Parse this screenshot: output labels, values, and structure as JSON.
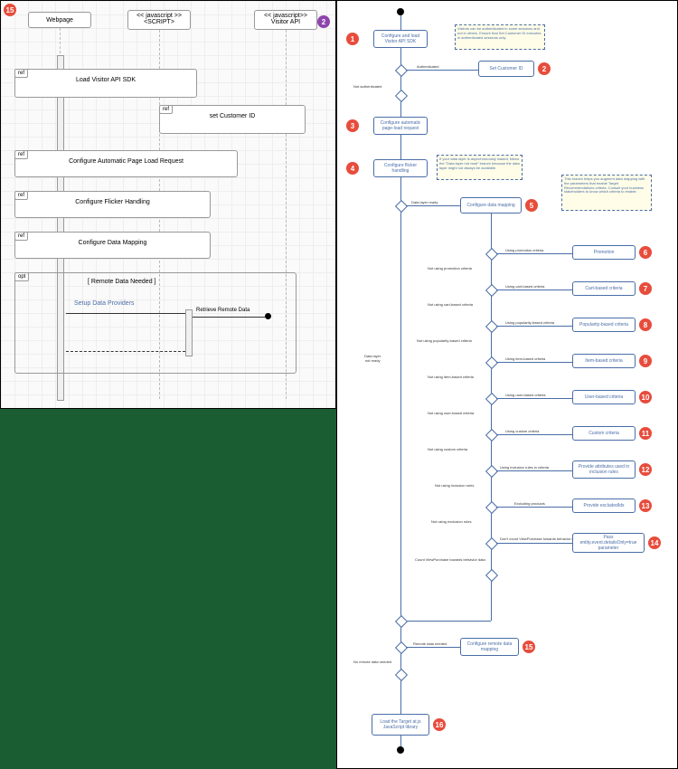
{
  "left": {
    "badge15": "15",
    "badge2": "2",
    "heads": {
      "webpage": "Webpage",
      "script": "<< javascript >>\n<SCRIPT>",
      "visitor": "<< javascript>>\nVisitor API"
    },
    "refs": {
      "load_sdk": "Load Visitor API SDK",
      "set_customer": "set Customer ID",
      "auto_page": "Configure Automatic Page Load Request",
      "flicker": "Configure Flicker Handling",
      "data_map": "Configure Data Mapping"
    },
    "opt_guard": "[ Remote Data Needed ]",
    "setup_providers": "Setup Data Providers",
    "retrieve": "Retrieve Remote Data",
    "ref_label": "ref",
    "opt_label": "opt"
  },
  "right": {
    "badges": {
      "1": "1",
      "2": "2",
      "3": "3",
      "4": "4",
      "5": "5",
      "6": "6",
      "7": "7",
      "8": "8",
      "9": "9",
      "10": "10",
      "11": "11",
      "12": "12",
      "13": "13",
      "14": "14",
      "15": "15",
      "16": "16"
    },
    "nodes": {
      "n1": "Configure and load\nVisitor API SDK",
      "n2": "Set Customer ID",
      "n3": "Configure automatic\npage-load request",
      "n4": "Configure\nflicker handling",
      "n5": "Configure data mapping",
      "n6": "Promotion",
      "n7": "Cart-based criteria",
      "n8": "Popularity-based criteria",
      "n9": "Item-based criteria",
      "n10": "User-based criteria",
      "n11": "Custom criteria",
      "n12": "Provide attributes\nused in inclusion rules",
      "n13": "Provide excludedIds",
      "n14": "Pass\nentity.event.detailsOnly=true\nparameter",
      "n15": "Configure remote\ndata mapping",
      "n16": "Load the Target\nat.js JavaScript\nlibrary"
    },
    "notes": {
      "note_a": "Visitors can be authenticated in some sessions and not in others. Ensure that Set Customer ID executes in authenticated sessions only.",
      "note_b": "If your data layer is asynchronously loaded, follow the \"Data layer not read\" branch because the data layer might not always be available.",
      "note_c": "This branch helps you augment data mapping with the parameters that enable Target Recommendations criteria. Consult your business stakeholders to know which criteria to enable."
    },
    "labels": {
      "auth": "Authenticated",
      "not_auth": "Not authenticated",
      "dl_ready": "Data layer ready",
      "dl_not": "Data layer\nnot ready",
      "use_promo": "Using promotion criteria",
      "not_promo": "Not using promotion criteria",
      "use_cart": "Using cart-based criteria",
      "not_cart": "Not using cart-based criteria",
      "use_pop": "Using popularity-based criteria",
      "not_pop": "Not using popularity-based criteria",
      "use_item": "Using item-based criteria",
      "not_item": "Not using item-based criteria",
      "use_user": "Using user-based criteria",
      "not_user": "Not using user-based criteria",
      "use_custom": "Using custom criteria",
      "not_custom": "Not using custom criteria",
      "use_incl": "Using inclusion rules in criteria",
      "not_incl": "Not using inclusion rules",
      "excl_prod": "Excluding products",
      "not_excl": "Not using exclusion rules",
      "no_count": "Don't count ViewPurchase towards behavior data",
      "count": "Count ViewPurchase towards behavior data",
      "remote": "Remote data needed",
      "no_remote": "No remote data needed"
    }
  }
}
